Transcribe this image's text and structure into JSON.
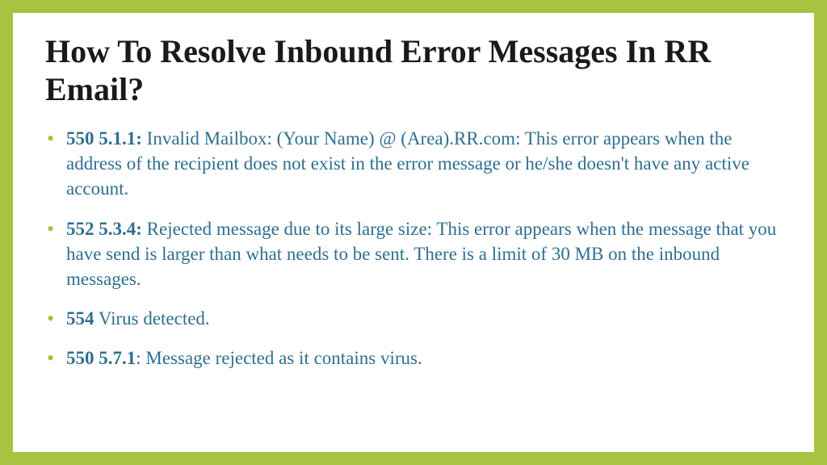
{
  "title": "How To Resolve Inbound Error Messages In RR Email?",
  "bullets": [
    {
      "code": "550 5.1.1:",
      "text": " Invalid Mailbox: (Your Name) @ (Area).RR.com: This error appears when the address of the recipient does not exist in the error message or he/she doesn't have any active account."
    },
    {
      "code": "552 5.3.4:",
      "text": " Rejected message due to its large size: This error appears when the message that you have send is larger than what needs to be sent. There is a limit of 30 MB on the inbound messages."
    },
    {
      "code": "554",
      "text": " Virus detected."
    },
    {
      "code": "550 5.7.1",
      "text": ": Message rejected as it contains virus."
    }
  ]
}
